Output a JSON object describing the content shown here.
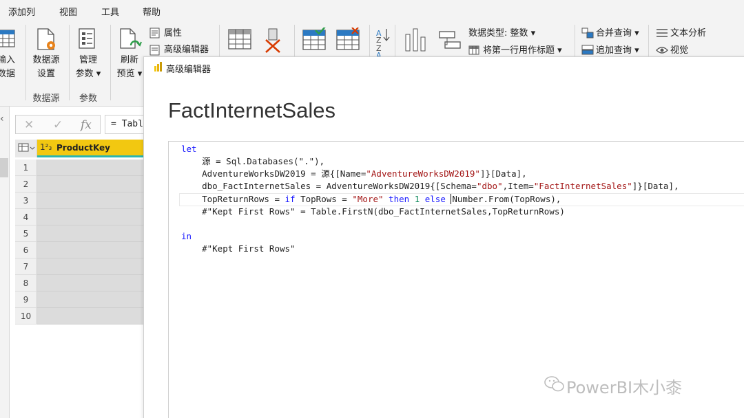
{
  "menu": [
    "添加列",
    "视图",
    "工具",
    "帮助"
  ],
  "ribbon": {
    "input_data_l1": "输入",
    "input_data_l2": "数据",
    "datasource_l1": "数据源",
    "datasource_l2": "设置",
    "group_datasource": "数据源",
    "manage_l1": "管理",
    "manage_l2": "参数 ▾",
    "group_params": "参数",
    "refresh_l1": "刷新",
    "refresh_l2": "预览 ▾",
    "properties": "属性",
    "advanced_editor": "高级编辑器",
    "data_type": "数据类型: 整数 ▾",
    "first_row_header": "将第一行用作标题 ▾",
    "merge_queries": "合并查询 ▾",
    "append_queries": "追加查询 ▾",
    "text_analytics": "文本分析",
    "vision": "视觉"
  },
  "formula_bar": {
    "cancel": "✕",
    "confirm": "✓",
    "fx": "fx",
    "value": "= Table.FirstN("
  },
  "grid": {
    "column_type": "1²₃",
    "column_name": "ProductKey",
    "rows": [
      "1",
      "2",
      "3",
      "4",
      "5",
      "6",
      "7",
      "8",
      "9",
      "10"
    ]
  },
  "dialog": {
    "title": "高级编辑器",
    "query_name": "FactInternetSales",
    "code": {
      "l1_kw": "let",
      "l2": "    源 = Sql.Databases(\".\"),",
      "l3_a": "    AdventureWorksDW2019 = 源{[Name=",
      "l3_s": "\"AdventureWorksDW2019\"",
      "l3_b": "]}[Data],",
      "l4_a": "    dbo_FactInternetSales = AdventureWorksDW2019{[Schema=",
      "l4_s1": "\"dbo\"",
      "l4_b": ",Item=",
      "l4_s2": "\"FactInternetSales\"",
      "l4_c": "]}[Data],",
      "l5_a": "    TopReturnRows = ",
      "l5_if": "if",
      "l5_b": " TopRows = ",
      "l5_s": "\"More\"",
      "l5_then": " then ",
      "l5_n": "1",
      "l5_else": " else ",
      "l5_c": "Number.From(TopRows),",
      "l6": "    #\"Kept First Rows\" = Table.FirstN(dbo_FactInternetSales,TopReturnRows)",
      "l7_kw": "in",
      "l8": "    #\"Kept First Rows\""
    }
  },
  "watermark": "PowerBI木小桼",
  "colors": {
    "accent_yellow": "#f2c811",
    "accent_teal": "#2bb5b0",
    "keyword": "#1a1aff",
    "string": "#a31515"
  }
}
